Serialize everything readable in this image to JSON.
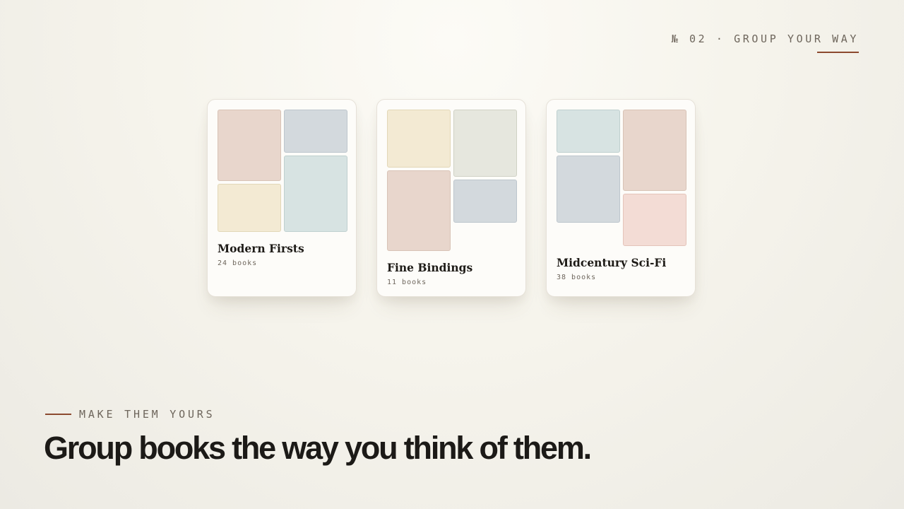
{
  "header": {
    "step_label": "№ 02 · GROUP YOUR WAY"
  },
  "collections": [
    {
      "title": "Modern Firsts",
      "count": "24 books"
    },
    {
      "title": "Fine Bindings",
      "count": "11 books"
    },
    {
      "title": "Midcentury Sci-Fi",
      "count": "38 books"
    }
  ],
  "footer": {
    "eyebrow": "MAKE THEM YOURS",
    "headline": "Group books the way you think of them."
  },
  "colors": {
    "accent": "#8c4a2f",
    "background": "#f6f4ec",
    "card": "#fdfcf9",
    "text": "#1c1a17",
    "muted": "#6e665c",
    "tile_rose": "#e8d6cc",
    "tile_slate": "#d3d9dd",
    "tile_cream": "#f3ead3",
    "tile_mint": "#d7e3e2",
    "tile_sage": "#e6e7de",
    "tile_blush": "#f3dcd5"
  }
}
